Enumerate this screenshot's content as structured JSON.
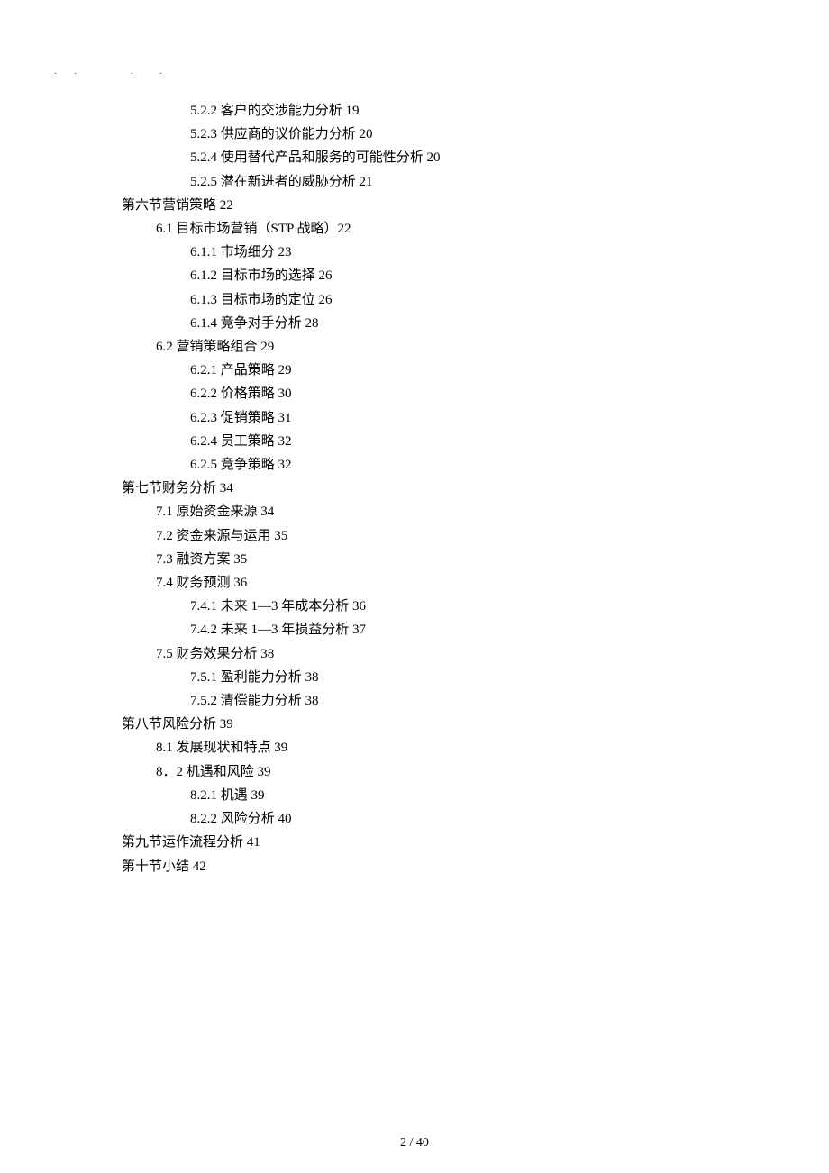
{
  "dots": ".　　.　　　　　　.　　　.",
  "toc": [
    {
      "indent": 2,
      "text": "5.2.2 客户的交涉能力分析 19"
    },
    {
      "indent": 2,
      "text": "5.2.3 供应商的议价能力分析 20"
    },
    {
      "indent": 2,
      "text": "5.2.4  使用替代产品和服务的可能性分析 20"
    },
    {
      "indent": 2,
      "text": "5.2.5 潜在新进者的威胁分析 21"
    },
    {
      "indent": 0,
      "text": "第六节营销策略 22"
    },
    {
      "indent": 1,
      "text": "6.1  目标市场营销（STP 战略）22"
    },
    {
      "indent": 2,
      "text": "6.1.1 市场细分 23"
    },
    {
      "indent": 2,
      "text": "6.1.2 目标市场的选择 26"
    },
    {
      "indent": 2,
      "text": "6.1.3 目标市场的定位 26"
    },
    {
      "indent": 2,
      "text": "6.1.4 竞争对手分析 28"
    },
    {
      "indent": 1,
      "text": "6.2 营销策略组合 29"
    },
    {
      "indent": 2,
      "text": "6.2.1 产品策略 29"
    },
    {
      "indent": 2,
      "text": "6.2.2 价格策略 30"
    },
    {
      "indent": 2,
      "text": "6.2.3 促销策略 31"
    },
    {
      "indent": 2,
      "text": "6.2.4 员工策略 32"
    },
    {
      "indent": 2,
      "text": "6.2.5 竞争策略 32"
    },
    {
      "indent": 0,
      "text": "第七节财务分析 34"
    },
    {
      "indent": 1,
      "text": "7.1 原始资金来源 34"
    },
    {
      "indent": 1,
      "text": "7.2 资金来源与运用 35"
    },
    {
      "indent": 1,
      "text": "7.3 融资方案 35"
    },
    {
      "indent": 1,
      "text": "7.4 财务预测 36"
    },
    {
      "indent": 2,
      "text": "7.4.1 未来 1—3 年成本分析 36"
    },
    {
      "indent": 2,
      "text": "7.4.2 未来 1—3 年损益分析 37"
    },
    {
      "indent": 1,
      "text": "7.5 财务效果分析 38"
    },
    {
      "indent": 2,
      "text": "7.5.1 盈利能力分析 38"
    },
    {
      "indent": 2,
      "text": "7.5.2 清偿能力分析 38"
    },
    {
      "indent": 0,
      "text": "第八节风险分析 39"
    },
    {
      "indent": 1,
      "text": "8.1 发展现状和特点 39"
    },
    {
      "indent": 1,
      "text": "8．2 机遇和风险 39"
    },
    {
      "indent": 2,
      "text": "8.2.1 机遇 39"
    },
    {
      "indent": 2,
      "text": "8.2.2 风险分析 40"
    },
    {
      "indent": 0,
      "text": "第九节运作流程分析 41"
    },
    {
      "indent": 0,
      "text": "第十节小结 42"
    }
  ],
  "footer": "2  / 40"
}
